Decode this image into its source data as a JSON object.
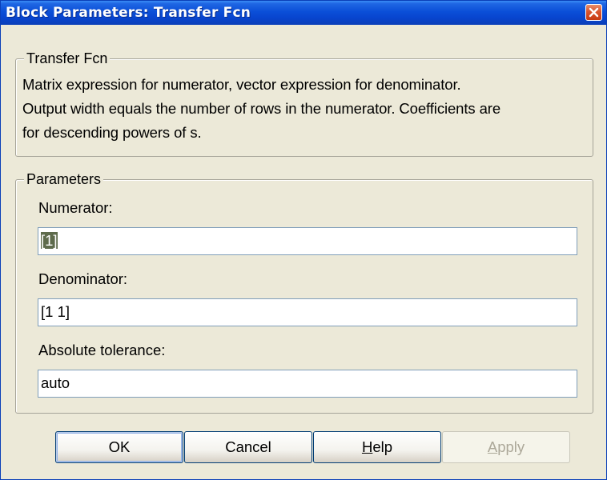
{
  "window": {
    "title": "Block Parameters: Transfer Fcn"
  },
  "block_group": {
    "legend": "Transfer Fcn",
    "description_lines": [
      "Matrix expression for numerator, vector expression for denominator.",
      "Output width equals the number of rows in the numerator.  Coefficients are",
      "for descending powers of s."
    ]
  },
  "parameters_group": {
    "legend": "Parameters",
    "fields": [
      {
        "label": "Numerator:",
        "value": "[1]",
        "selected": true
      },
      {
        "label": "Denominator:",
        "value": "[1 1]",
        "selected": false
      },
      {
        "label": "Absolute tolerance:",
        "value": "auto",
        "selected": false
      }
    ]
  },
  "buttons": {
    "ok": "OK",
    "cancel": "Cancel",
    "help_mnemonic": "H",
    "help_rest": "elp",
    "apply_mnemonic": "A",
    "apply_rest": "pply"
  },
  "colors": {
    "titlebar": "#0b4fd8",
    "dialog_bg": "#ece9d8",
    "close_button": "#d9542e",
    "selection_highlight": "#5e6b4c"
  },
  "icons": {
    "close": "close-x-icon"
  }
}
